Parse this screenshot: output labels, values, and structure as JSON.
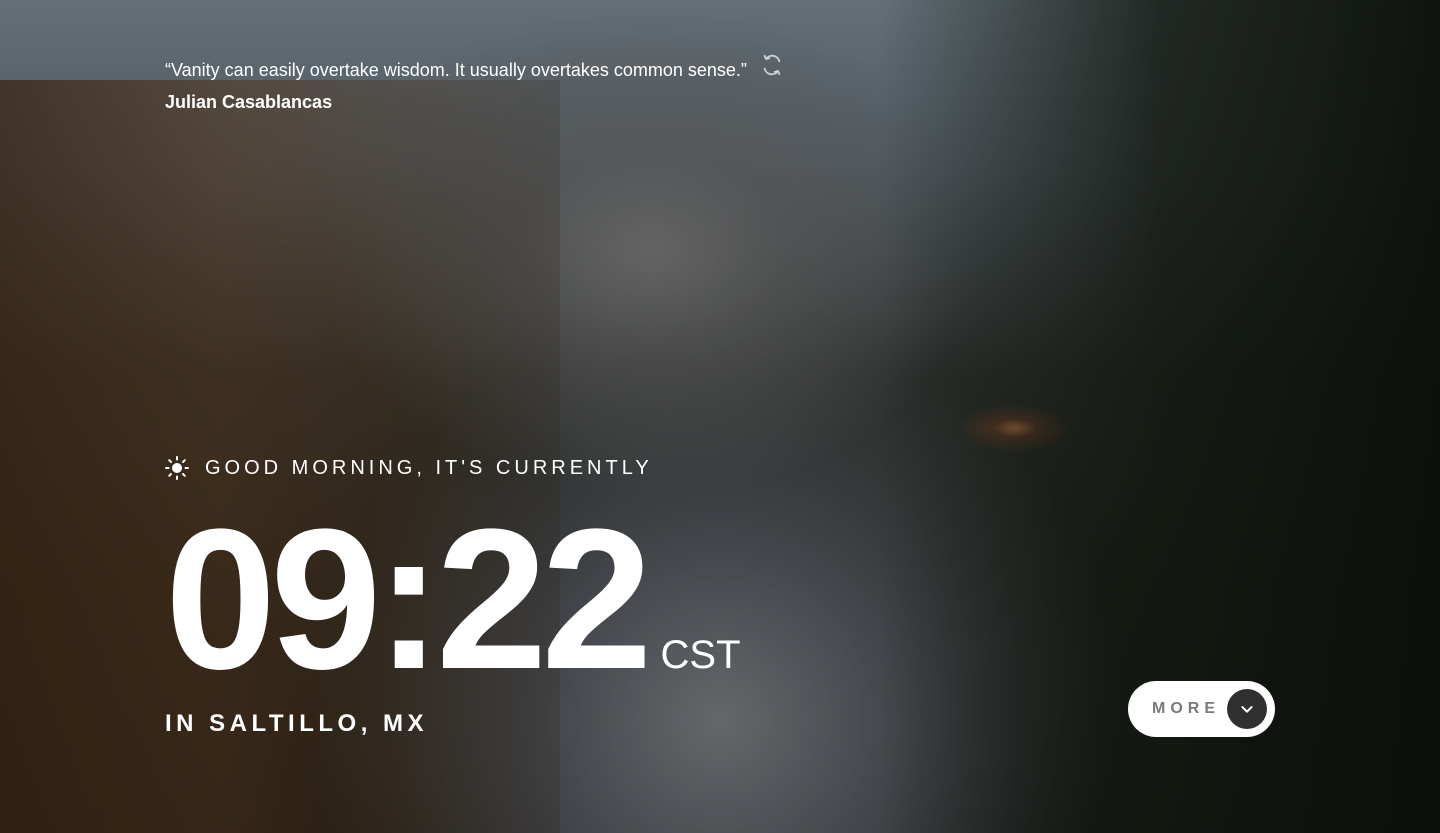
{
  "quote": {
    "text": "“Vanity can easily overtake wisdom. It usually overtakes common sense.”",
    "author": "Julian Casablancas",
    "refresh_icon": "refresh-icon"
  },
  "greeting": {
    "icon": "sun-icon",
    "text": "GOOD MORNING, IT'S CURRENTLY"
  },
  "clock": {
    "time": "09:22",
    "timezone": "CST"
  },
  "location": {
    "text": "IN SALTILLO, MX"
  },
  "more_button": {
    "label": "MORE",
    "icon": "chevron-down-icon"
  },
  "colors": {
    "text": "#ffffff",
    "button_bg": "#ffffff",
    "button_text": "#7a7a7a",
    "arrow_bg": "#303030"
  }
}
